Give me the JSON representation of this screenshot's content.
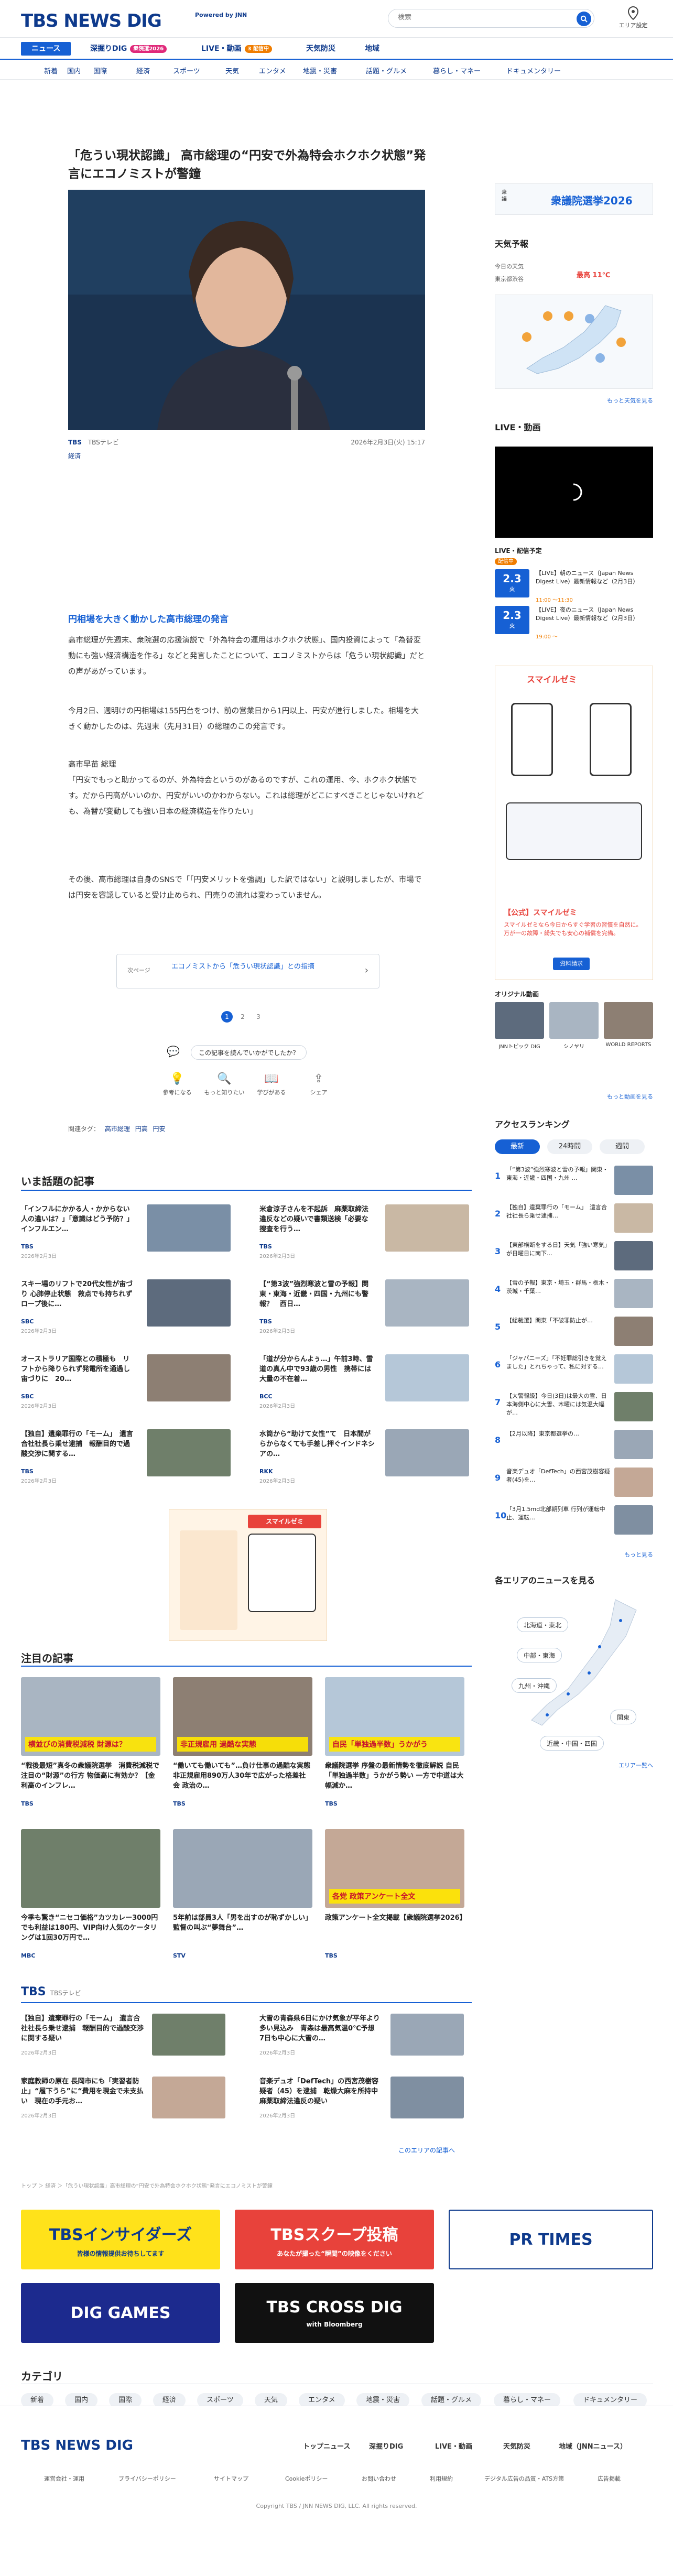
{
  "header": {
    "logo": "TBS NEWS DIG",
    "powered": "Powered by JNN",
    "search_placeholder": "検索",
    "area_label": "エリア設定"
  },
  "nav_main": [
    {
      "label": "ニュース",
      "active": true
    },
    {
      "label": "深掘りDIG",
      "badge": "衆院選2026",
      "badge_color": "#e0297a"
    },
    {
      "label": "LIVE・動画",
      "badge": "3 配信中",
      "badge_color": "#f07d00"
    },
    {
      "label": "天気防災"
    },
    {
      "label": "地域"
    }
  ],
  "nav_sub": [
    "新着",
    "国内",
    "国際",
    "経済",
    "スポーツ",
    "天気",
    "エンタメ",
    "地震・災害",
    "話題・グルメ",
    "暮らし・マネー",
    "ドキュメンタリー"
  ],
  "article": {
    "title": "「危うい現状認識」 高市総理の“円安で外為特会ホクホク状態”発言にエコノミストが警鐘",
    "source": "TBS",
    "source_sub": "TBSテレビ",
    "datetime": "2026年2月3日(火) 15:17",
    "tag": "経済",
    "subheading": "円相場を大きく動かした高市総理の発言",
    "paragraphs": [
      "高市総理が先週末、衆院選の応援演説で「外為特会の運用はホクホク状態」、国内投資によって「為替変動にも強い経済構造を作る」などと発言したことについて、エコノミストからは「危うい現状認識」だとの声があがっています。",
      "今月2日、週明けの円相場は155円台をつけ、前の営業日から1円以上、円安が進行しました。相場を大きく動かしたのは、先週末（先月31日）の総理のこの発言です。",
      "高市早苗 総理\n「円安でもっと助かってるのが、外為特会というのがあるのですが、これの運用、今、ホクホク状態です。だから円高がいいのか、円安がいいのかわからない。これは総理がどこにすべきことじゃないけれども、為替が変動しても強い日本の経済構造を作りたい」",
      "その後、高市総理は自身のSNSで「「円安メリットを強調」した訳ではない」と説明しましたが、市場では円安を容認していると受け止められ、円売りの流れは変わっていません。"
    ],
    "related_label": "次ページ",
    "related_text": "エコノミストから「危うい現状認識」との指摘",
    "pages": [
      "1",
      "2",
      "3"
    ],
    "ask": "この記事を読んでいかがでしたか？",
    "reactions": [
      "参考になる",
      "もっと知りたい",
      "学びがある",
      "シェア"
    ],
    "tags_label": "関連タグ：",
    "tags": [
      "高市総理",
      "円高",
      "円安"
    ]
  },
  "popular": {
    "title": "いま話題の記事",
    "items": [
      {
        "t": "「インフルにかかる人・かからない人の違いは？」「意識はどう予防？」インフルエン…",
        "s": "TBS",
        "d": "2026年2月3日"
      },
      {
        "t": "米倉涼子さんを不起訴　麻薬取締法違反などの疑いで書類送検「必要な捜査を行う…",
        "s": "TBS",
        "d": "2026年2月3日"
      },
      {
        "t": "スキー場のリフトで20代女性が宙づり 心肺停止状態　救点でも持ちれずロープ後に…",
        "s": "SBC",
        "d": "2026年2月3日"
      },
      {
        "t": "【“第3波”強烈寒波と雪の予報】関東・東海・近畿・四国・九州にも警報？　西日…",
        "s": "TBS",
        "d": "2026年2月3日"
      },
      {
        "t": "オーストラリア国際との積極も　リフトから降りられず発電所を通過し宙づりに　20…",
        "s": "SBC",
        "d": "2026年2月3日"
      },
      {
        "t": "「道が分からんよぅ…」午前3時、雪道の真ん中で93歳の男性　携帯には大量の不在着…",
        "s": "BCC",
        "d": "2026年2月3日"
      },
      {
        "t": "【独自】遺棄罪行の「モーム」　遺言合社社長ら乗せ逮捕　報酬目的で過酸交渉に関する…",
        "s": "TBS",
        "d": "2026年2月3日"
      },
      {
        "t": "水筒から“助けて女性”て　日本間がらからなくても手差し押ぐインドネシアの…",
        "s": "RKK",
        "d": "2026年2月3日"
      }
    ]
  },
  "featured": {
    "title": "注目の記事",
    "items": [
      {
        "t": "“戦後最短”真冬の衆議院選挙　消費税減税で注目の“財源”の行方 物価高に有効か？【金利高のインフレ…",
        "s": "TBS",
        "d": "2026年2月3日",
        "img": "横並びの消費税減税 財源は？"
      },
      {
        "t": "“働いても働いても”…負け仕事の過酷な実態　非正規雇用890万人30年で広がった格差社会 政治の…",
        "s": "TBS",
        "d": "2026年2月3日",
        "img": "非正規雇用 過酷な実態"
      },
      {
        "t": "衆議院選挙 序盤の最新情勢を徹底解説 自民「単独過半数」うかがう勢い 一方で中道は大幅減か…",
        "s": "TBS",
        "d": "2026年2月3日",
        "img": "自民「単独過半数」うかがう"
      },
      {
        "t": "今季も驚き“ニセコ価格”カツカレー3000円でも利益は180円、VIP向け人気のケータリングは1回30万円で…",
        "s": "MBC",
        "d": "2026年2月3日",
        "img": ""
      },
      {
        "t": "5年前は部員3人「男を出すのが恥ずかしい」監督の叫ぶ“夢舞台”…",
        "s": "STV",
        "d": "2026年2月3日",
        "img": ""
      },
      {
        "t": "政策アンケート全文掲載【衆議院選挙2026】",
        "s": "TBS",
        "d": "2026年2月3日",
        "img": "各党 政策アンケート全文"
      }
    ]
  },
  "local": {
    "title": "TBS",
    "sub": "TBSテレビ",
    "items": [
      {
        "t": "【独自】遺棄罪行の「モーム」　遺言合社社長ら乗せ逮捕　報酬目的で過酸交渉に関する疑い",
        "d": "2026年2月3日"
      },
      {
        "t": "大雪の青森県6日にかけ気象が平年より多い見込み　青森は最高気温0℃予想　7日も中心に大雪の…",
        "d": "2026年2月3日"
      },
      {
        "t": "家庭教師の原在 長岡市にも「実習者防止」“履下うら”に“費用を現金で未支払い　現在の手元お…",
        "d": "2026年2月3日"
      },
      {
        "t": "音楽デュオ「DefTech」の西宮茂樹容疑者（45）を逮捕　乾燥大麻を所持中 麻薬取締法違反の疑い",
        "d": "2026年2月3日"
      }
    ],
    "more": "このエリアの記事へ"
  },
  "breadcrumb": "トップ ＞ 経済 ＞「危うい現状認識」高市総理の“円安で外為特会ホクホク状態”発言にエコノミストが警鐘",
  "banners": [
    {
      "label": "TBSインサイダーズ",
      "sub": "皆様の情報提供お待ちしてます",
      "bg": "#ffe21a",
      "fg": "#0e3a8c"
    },
    {
      "label": "TBSスクープ投稿",
      "sub": "あなたが撮った“瞬間”の映像をください",
      "bg": "#e8423b",
      "fg": "#ffffff"
    },
    {
      "label": "PR TIMES",
      "sub": "",
      "bg": "#ffffff",
      "fg": "#0e3a8c"
    },
    {
      "label": "DIG GAMES",
      "sub": "",
      "bg": "#1c2a8e",
      "fg": "#ffffff"
    },
    {
      "label": "TBS CROSS DIG",
      "sub": "with Bloomberg",
      "bg": "#111111",
      "fg": "#ffffff"
    }
  ],
  "categories": {
    "title": "カテゴリ",
    "items": [
      "新着",
      "国内",
      "国際",
      "経済",
      "スポーツ",
      "天気",
      "エンタメ",
      "地震・災害",
      "話題・グルメ",
      "暮らし・マネー",
      "ドキュメンタリー"
    ]
  },
  "sidebar": {
    "election": "衆議院選挙2026",
    "weather": {
      "title": "天気予報",
      "label": "今日の天気",
      "area": "東京都渋谷",
      "temp_high": "最高 11℃",
      "more": "もっと天気を見る"
    },
    "live": {
      "title": "LIVE・動画",
      "schedule_title": "LIVE・配信予定",
      "status": "配信中",
      "items": [
        {
          "date": "2.3",
          "day": "火",
          "t": "【LIVE】朝のニュース（Japan News Digest Live）最新情報など（2月3日）",
          "time": "11:00 〜11:30"
        },
        {
          "date": "2.3",
          "day": "火",
          "t": "【LIVE】夜のニュース（Japan News Digest Live）最新情報など（2月3日）",
          "time": "19:00 〜"
        }
      ]
    },
    "ad": {
      "brand": "スマイルゼミ",
      "title": "【公式】スマイルゼミ",
      "text": "スマイルゼミなら今日からすぐ学習の習慣を自然に。万が一の故障・紛失でも安心の補償を完備。",
      "btn": "資料請求"
    },
    "original": {
      "title": "オリジナル動画",
      "items": [
        "JNNトピック DIG",
        "シノヤリ",
        "WORLD REPORTS"
      ],
      "more": "もっと動画を見る"
    },
    "ranking": {
      "title": "アクセスランキング",
      "tabs": [
        "最新",
        "24時間",
        "週間"
      ],
      "items": [
        "「“第3波”強烈寒波と雪の予報」関東・東海・近畿・四国・九州 …",
        "【独自】遺棄罪行の「モーム」　遺言合社社長ら乗せ逮捕…",
        "【東部横断をする日】天気「強い寒気」が日曜日に南下…",
        "【雪の予報】東京・埼玉・群馬・栃木・茨城・千葉…",
        "【総裁選】関東「不破罪防止が…",
        "「ジャパニーズ」「不妊罪総引きを覚えました」とれちゃって、私に対する…",
        "【大警報級】今日(3日)は最大の雪、日本海側中心に大雪、木曜には気温大幅が…",
        "【2月以降】東京都選挙の…",
        "音楽デュオ「DefTech」の西宮茂樹容疑者(45)を…",
        "「3月1.5md北部期列車 行列が運転中止、運転…"
      ],
      "more": "もっと見る"
    },
    "area": {
      "title": "各エリアのニュースを見る",
      "regions": [
        "北海道・東北",
        "中部・東海",
        "九州・沖縄",
        "関東",
        "近畿・中国・四国"
      ],
      "more": "エリア一覧へ"
    }
  },
  "footer": {
    "logo": "TBS NEWS DIG",
    "links": [
      "トップニュース",
      "深掘りDIG",
      "LIVE・動画",
      "天気防災",
      "地域（JNNニュース）"
    ],
    "sublinks": [
      "運営会社・運用",
      "プライバシーポリシー",
      "サイトマップ",
      "Cookieポリシー",
      "お問い合わせ",
      "利用規約",
      "デジタル広告の品質・ATS方策",
      "広告掲載"
    ],
    "copyright": "Copyright TBS / JNN NEWS DIG, LLC. All rights reserved."
  }
}
